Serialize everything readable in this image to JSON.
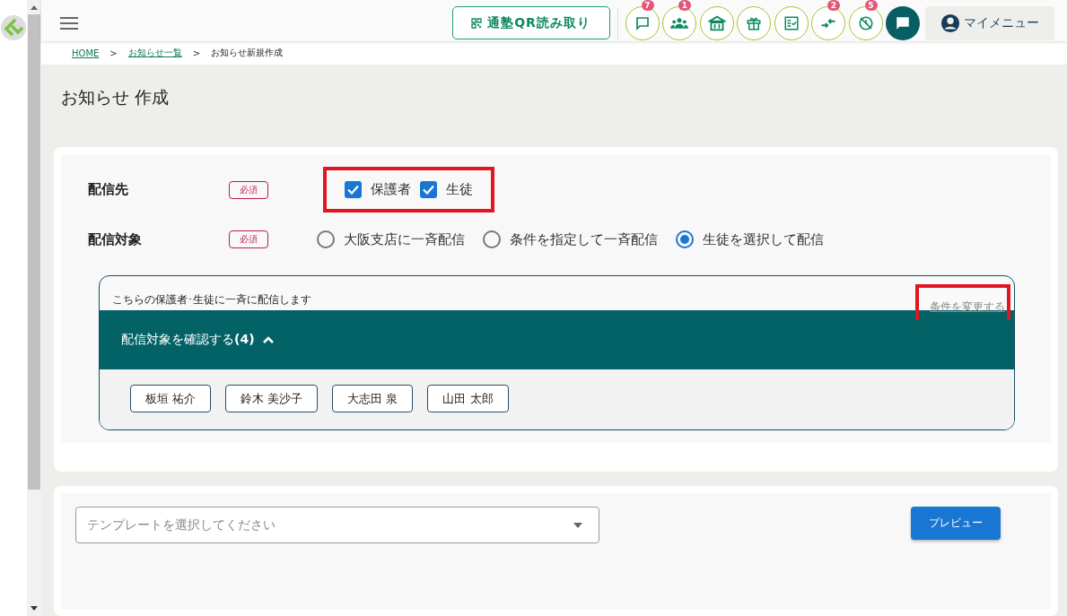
{
  "header": {
    "qr_button": "通塾QR読み取り",
    "icons": [
      {
        "kind": "chat",
        "badge": "7"
      },
      {
        "kind": "group",
        "badge": "1"
      },
      {
        "kind": "school"
      },
      {
        "kind": "gift"
      },
      {
        "kind": "checklist"
      },
      {
        "kind": "merge",
        "badge": "2"
      },
      {
        "kind": "blocked",
        "badge": "5"
      }
    ],
    "my_menu": "マイメニュー"
  },
  "breadcrumb": [
    {
      "label": "HOME",
      "link": true
    },
    {
      "label": "お知らせ一覧",
      "link": true
    },
    {
      "label": "お知らせ新規作成",
      "link": false
    }
  ],
  "breadcrumb_separator": ">",
  "page_title": "お知らせ 作成",
  "form": {
    "recipients": {
      "label": "配信先",
      "required_badge": "必須",
      "highlighted": true,
      "options": [
        {
          "label": "保護者",
          "checked": true
        },
        {
          "label": "生徒",
          "checked": true
        }
      ]
    },
    "target": {
      "label": "配信対象",
      "required_badge": "必須",
      "options": [
        {
          "label": "大阪支店に一斉配信",
          "selected": false
        },
        {
          "label": "条件を指定して一斉配信",
          "selected": false
        },
        {
          "label": "生徒を選択して配信",
          "selected": true
        }
      ]
    },
    "target_box": {
      "description": "こちらの保護者･生徒に一斉に配信します",
      "change_link": "条件を変更する",
      "change_link_highlighted": true,
      "confirm_label": "配信対象を確認する",
      "confirm_count": "(4)",
      "expanded": true,
      "students": [
        "板垣 祐介",
        "鈴木 美沙子",
        "大志田 泉",
        "山田 太郎"
      ]
    }
  },
  "template": {
    "placeholder": "テンプレートを選択してください",
    "preview_button": "プレビュー"
  }
}
